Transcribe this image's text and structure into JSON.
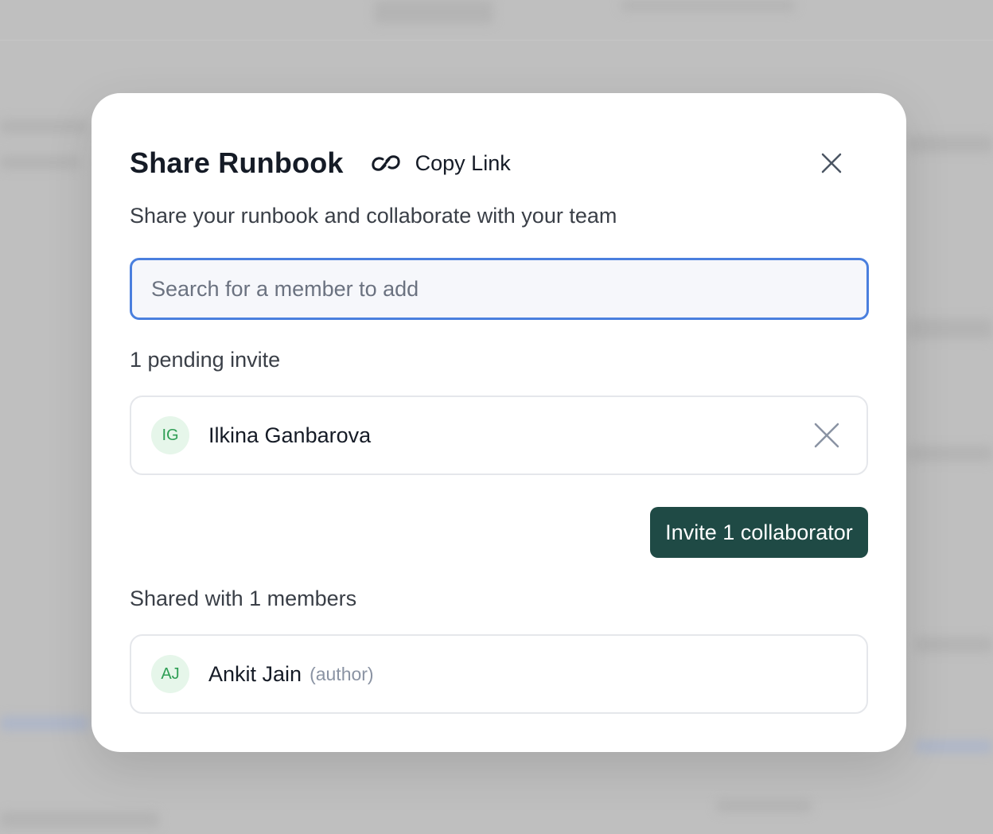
{
  "modal": {
    "title": "Share Runbook",
    "copy_link_label": "Copy Link",
    "subtitle": "Share your runbook and collaborate with your team",
    "search_placeholder": "Search for a member to add",
    "pending_label": "1 pending invite",
    "pending_invites": [
      {
        "initials": "IG",
        "name": "Ilkina Ganbarova"
      }
    ],
    "invite_button_label": "Invite 1 collaborator",
    "shared_label": "Shared with 1 members",
    "members": [
      {
        "initials": "AJ",
        "name": "Ankit Jain",
        "role": "(author)"
      }
    ]
  },
  "icons": {
    "copy_link": "link-icon",
    "close": "close-icon",
    "remove": "remove-icon"
  },
  "colors": {
    "accent_focus": "#4a7fde",
    "primary_button": "#1f4a45",
    "avatar_bg": "#e6f6ea",
    "avatar_text": "#2f9e55"
  }
}
